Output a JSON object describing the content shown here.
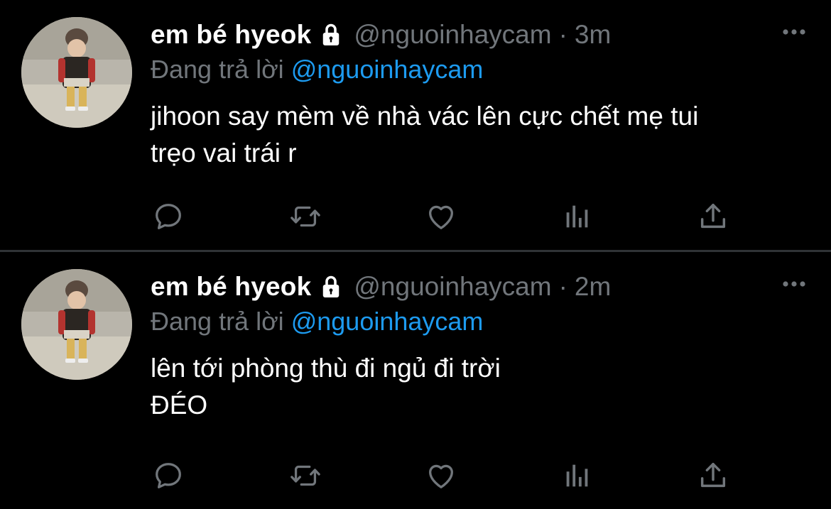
{
  "colors": {
    "background": "#000000",
    "divider": "#2f3336",
    "primary_text": "#ffffff",
    "secondary_text": "#71767b",
    "mention": "#1d9bf0"
  },
  "tweets": [
    {
      "display_name": "em bé hyeok",
      "lock_icon": "lock-icon",
      "handle": "@nguoinhaycam",
      "separator": "·",
      "time": "3m",
      "reply_prefix": "Đang trả lời",
      "reply_mention": "@nguoinhaycam",
      "text": "jihoon say mèm về nhà vác lên cực chết mẹ tui\ntrẹo vai trái r",
      "icons": [
        "reply-icon",
        "retweet-icon",
        "like-icon",
        "views-icon",
        "share-icon",
        "more-icon"
      ]
    },
    {
      "display_name": "em bé hyeok",
      "lock_icon": "lock-icon",
      "handle": "@nguoinhaycam",
      "separator": "·",
      "time": "2m",
      "reply_prefix": "Đang trả lời",
      "reply_mention": "@nguoinhaycam",
      "text": "lên tới phòng thù đi ngủ đi trời\nĐÉO",
      "icons": [
        "reply-icon",
        "retweet-icon",
        "like-icon",
        "views-icon",
        "share-icon",
        "more-icon"
      ]
    }
  ]
}
